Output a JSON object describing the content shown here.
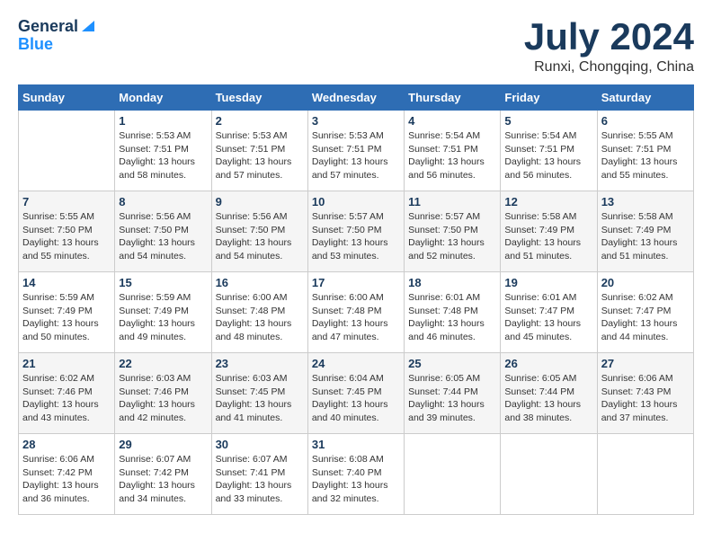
{
  "header": {
    "logo_line1": "General",
    "logo_line2": "Blue",
    "month": "July 2024",
    "location": "Runxi, Chongqing, China"
  },
  "days_of_week": [
    "Sunday",
    "Monday",
    "Tuesday",
    "Wednesday",
    "Thursday",
    "Friday",
    "Saturday"
  ],
  "weeks": [
    [
      {
        "day": "",
        "info": ""
      },
      {
        "day": "1",
        "info": "Sunrise: 5:53 AM\nSunset: 7:51 PM\nDaylight: 13 hours\nand 58 minutes."
      },
      {
        "day": "2",
        "info": "Sunrise: 5:53 AM\nSunset: 7:51 PM\nDaylight: 13 hours\nand 57 minutes."
      },
      {
        "day": "3",
        "info": "Sunrise: 5:53 AM\nSunset: 7:51 PM\nDaylight: 13 hours\nand 57 minutes."
      },
      {
        "day": "4",
        "info": "Sunrise: 5:54 AM\nSunset: 7:51 PM\nDaylight: 13 hours\nand 56 minutes."
      },
      {
        "day": "5",
        "info": "Sunrise: 5:54 AM\nSunset: 7:51 PM\nDaylight: 13 hours\nand 56 minutes."
      },
      {
        "day": "6",
        "info": "Sunrise: 5:55 AM\nSunset: 7:51 PM\nDaylight: 13 hours\nand 55 minutes."
      }
    ],
    [
      {
        "day": "7",
        "info": "Sunrise: 5:55 AM\nSunset: 7:50 PM\nDaylight: 13 hours\nand 55 minutes."
      },
      {
        "day": "8",
        "info": "Sunrise: 5:56 AM\nSunset: 7:50 PM\nDaylight: 13 hours\nand 54 minutes."
      },
      {
        "day": "9",
        "info": "Sunrise: 5:56 AM\nSunset: 7:50 PM\nDaylight: 13 hours\nand 54 minutes."
      },
      {
        "day": "10",
        "info": "Sunrise: 5:57 AM\nSunset: 7:50 PM\nDaylight: 13 hours\nand 53 minutes."
      },
      {
        "day": "11",
        "info": "Sunrise: 5:57 AM\nSunset: 7:50 PM\nDaylight: 13 hours\nand 52 minutes."
      },
      {
        "day": "12",
        "info": "Sunrise: 5:58 AM\nSunset: 7:49 PM\nDaylight: 13 hours\nand 51 minutes."
      },
      {
        "day": "13",
        "info": "Sunrise: 5:58 AM\nSunset: 7:49 PM\nDaylight: 13 hours\nand 51 minutes."
      }
    ],
    [
      {
        "day": "14",
        "info": "Sunrise: 5:59 AM\nSunset: 7:49 PM\nDaylight: 13 hours\nand 50 minutes."
      },
      {
        "day": "15",
        "info": "Sunrise: 5:59 AM\nSunset: 7:49 PM\nDaylight: 13 hours\nand 49 minutes."
      },
      {
        "day": "16",
        "info": "Sunrise: 6:00 AM\nSunset: 7:48 PM\nDaylight: 13 hours\nand 48 minutes."
      },
      {
        "day": "17",
        "info": "Sunrise: 6:00 AM\nSunset: 7:48 PM\nDaylight: 13 hours\nand 47 minutes."
      },
      {
        "day": "18",
        "info": "Sunrise: 6:01 AM\nSunset: 7:48 PM\nDaylight: 13 hours\nand 46 minutes."
      },
      {
        "day": "19",
        "info": "Sunrise: 6:01 AM\nSunset: 7:47 PM\nDaylight: 13 hours\nand 45 minutes."
      },
      {
        "day": "20",
        "info": "Sunrise: 6:02 AM\nSunset: 7:47 PM\nDaylight: 13 hours\nand 44 minutes."
      }
    ],
    [
      {
        "day": "21",
        "info": "Sunrise: 6:02 AM\nSunset: 7:46 PM\nDaylight: 13 hours\nand 43 minutes."
      },
      {
        "day": "22",
        "info": "Sunrise: 6:03 AM\nSunset: 7:46 PM\nDaylight: 13 hours\nand 42 minutes."
      },
      {
        "day": "23",
        "info": "Sunrise: 6:03 AM\nSunset: 7:45 PM\nDaylight: 13 hours\nand 41 minutes."
      },
      {
        "day": "24",
        "info": "Sunrise: 6:04 AM\nSunset: 7:45 PM\nDaylight: 13 hours\nand 40 minutes."
      },
      {
        "day": "25",
        "info": "Sunrise: 6:05 AM\nSunset: 7:44 PM\nDaylight: 13 hours\nand 39 minutes."
      },
      {
        "day": "26",
        "info": "Sunrise: 6:05 AM\nSunset: 7:44 PM\nDaylight: 13 hours\nand 38 minutes."
      },
      {
        "day": "27",
        "info": "Sunrise: 6:06 AM\nSunset: 7:43 PM\nDaylight: 13 hours\nand 37 minutes."
      }
    ],
    [
      {
        "day": "28",
        "info": "Sunrise: 6:06 AM\nSunset: 7:42 PM\nDaylight: 13 hours\nand 36 minutes."
      },
      {
        "day": "29",
        "info": "Sunrise: 6:07 AM\nSunset: 7:42 PM\nDaylight: 13 hours\nand 34 minutes."
      },
      {
        "day": "30",
        "info": "Sunrise: 6:07 AM\nSunset: 7:41 PM\nDaylight: 13 hours\nand 33 minutes."
      },
      {
        "day": "31",
        "info": "Sunrise: 6:08 AM\nSunset: 7:40 PM\nDaylight: 13 hours\nand 32 minutes."
      },
      {
        "day": "",
        "info": ""
      },
      {
        "day": "",
        "info": ""
      },
      {
        "day": "",
        "info": ""
      }
    ]
  ]
}
